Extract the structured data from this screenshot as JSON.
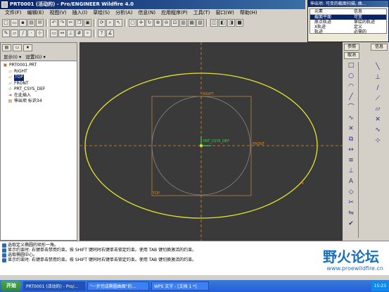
{
  "window": {
    "title": "PRT0001 (活动的) - Pro/ENGINEER Wildfire 4.0"
  },
  "menu": [
    "文件(F)",
    "编辑(E)",
    "视图(V)",
    "插入(I)",
    "草绘(S)",
    "分析(A)",
    "信息(N)",
    "应用程序(P)",
    "工具(T)",
    "窗口(W)",
    "帮助(H)"
  ],
  "model_tree": {
    "show_menu": "显示(I) ▾",
    "settings_menu": "设置(G) ▾",
    "items": [
      {
        "label": "PRT0001.PRT",
        "icon": "part-icon",
        "selected": false
      },
      {
        "label": "RIGHT",
        "icon": "datum-plane-icon",
        "selected": false
      },
      {
        "label": "TOP",
        "icon": "datum-plane-icon",
        "selected": true
      },
      {
        "label": "FRONT",
        "icon": "datum-plane-icon",
        "selected": false
      },
      {
        "label": "PRT_CSYS_DEF",
        "icon": "csys-icon",
        "selected": false
      },
      {
        "label": "在此插入",
        "icon": "insert-here-icon",
        "selected": false
      },
      {
        "label": "伸出项 标识34",
        "icon": "protrusion-icon",
        "selected": false
      }
    ]
  },
  "dialog": {
    "title": "伸出项: 可变的截面扫描, 曲...",
    "col_element": "元素",
    "col_info": "信息",
    "rows": [
      {
        "element": "截面平面",
        "info": "可变"
      },
      {
        "element": "原点轨迹",
        "info": "草绘的轨迹"
      },
      {
        "element": "X轨迹",
        "info": "定义"
      },
      {
        "element": "轨迹",
        "info": "必需的"
      }
    ],
    "selected_row": 0
  },
  "right_panel": {
    "ref_label": "参照",
    "cancel_label": "取消",
    "info_label": "信息",
    "tools": [
      "rectangle-icon",
      "circle-icon",
      "arc-icon",
      "line-icon",
      "fillet-icon",
      "spline-icon",
      "point-icon",
      "offset-icon",
      "dimension-icon",
      "modify-icon",
      "constraint-icon",
      "text-icon",
      "palette-icon",
      "trim-icon",
      "mirror-icon",
      "done-check-icon"
    ]
  },
  "canvas": {
    "labels": {
      "right": "RIGHT",
      "top": "TOP",
      "front": "FRONT",
      "csys": "PRT_CSYS_DEF"
    }
  },
  "messages": [
    "选取定义椭圆的矩形一角。",
    "显示约束时: 右键单击禁用约束。按 SHIFT 键同时右键单击锁定约束。使用 TAB 键切换激活的约束。",
    "选取椭圆中心。",
    "显示约束时: 右键单击禁用约束。按 SHIFT 键同时右键单击锁定约束。使用 TAB 键切换激活的约束。"
  ],
  "watermark": {
    "text": "野火论坛",
    "url": "www.proewildfire.cn"
  },
  "taskbar": {
    "start": "开始",
    "items": [
      "PRT0001 (活动的) - Pro/...",
      "\"一步完成椭圆曲面\"的...",
      "WPS 文字 - [文档 1 *]"
    ],
    "clock": "15:23"
  },
  "colors": {
    "canvas_bg": "#3a3a3a",
    "ellipse": "#e6e32a",
    "datum": "#b8834a",
    "axis": "#d88a2a",
    "csys": "#46d246"
  }
}
